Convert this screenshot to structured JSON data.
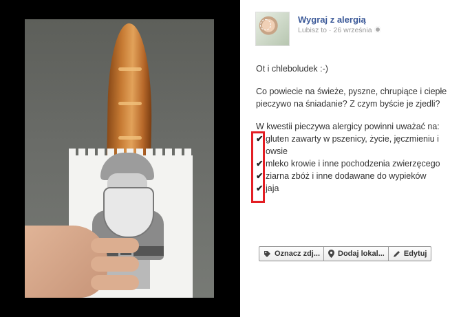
{
  "post": {
    "page_name": "Wygraj z alergią",
    "meta_like": "Lubisz to",
    "meta_sep": "·",
    "date": "26 września",
    "paragraphs": [
      "Ot i chleboludek :-)",
      "Co powiecie na świeże, pyszne, chrupiące i ciepłe pieczywo na śniadanie? Z czym byście je zjedli?"
    ],
    "list_intro": "W kwestii pieczywa alergicy powinni uważać na:",
    "check_mark": "✔",
    "list_items": [
      "gluten zawarty w pszenicy, życie, jęczmieniu i owsie",
      "mleko krowie i inne pochodzenia zwierzęcego",
      "ziarna zbóż i inne dodawane do wypieków",
      "jaja"
    ]
  },
  "actions": {
    "tag_label": "Oznacz zdj...",
    "location_label": "Dodaj lokal...",
    "edit_label": "Edytuj"
  },
  "icons": {
    "tag": "tag-icon",
    "location": "map-pin-icon",
    "edit": "pencil-icon",
    "privacy": "globe-icon"
  },
  "colors": {
    "page_name": "#3b5998",
    "highlight": "#e31e24",
    "photo_bg": "#000000"
  }
}
